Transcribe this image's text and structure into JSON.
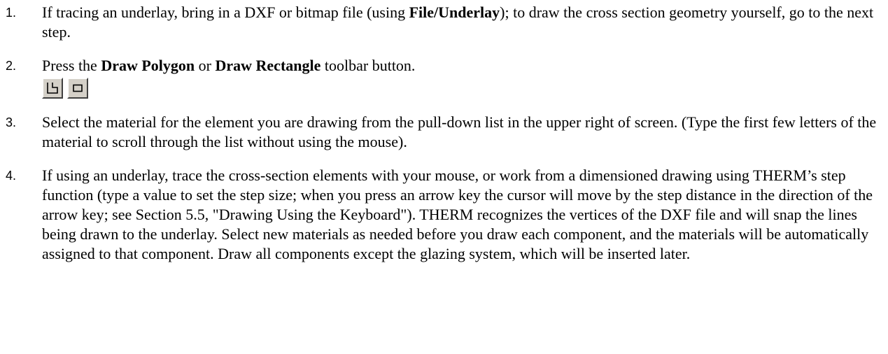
{
  "steps": [
    {
      "number": "1.",
      "pre": "If tracing an underlay, bring in a DXF or bitmap file (using ",
      "bold1": "File/Underlay",
      "post": "); to draw the cross section geometry yourself, go to the next step."
    },
    {
      "number": "2.",
      "pre": "Press the ",
      "bold1": "Draw Polygon",
      "mid": " or ",
      "bold2": "Draw Rectangle",
      "post": " toolbar button.",
      "icons": [
        "draw-polygon-icon",
        "draw-rectangle-icon"
      ]
    },
    {
      "number": "3.",
      "text": "Select the material for the element you are drawing from the pull-down list in the upper right of screen.  (Type the first few letters of the material to scroll through the list without using the mouse)."
    },
    {
      "number": "4.",
      "text": "If using an underlay, trace the cross-section elements with your mouse, or work from a dimensioned drawing using THERM’s step function (type a value to set the step size; when you press an arrow key the cursor will move by the step distance in the direction of the arrow key; see Section 5.5, \"Drawing Using the Keyboard\").  THERM recognizes the vertices of the DXF file and will snap the lines being drawn to the underlay. Select new materials as needed before you draw each component, and the materials will be automatically assigned to that component.  Draw all components except the glazing system, which will be inserted later."
    }
  ],
  "colors": {
    "button_face": "#d4d0c8",
    "icon_stroke": "#000000"
  }
}
